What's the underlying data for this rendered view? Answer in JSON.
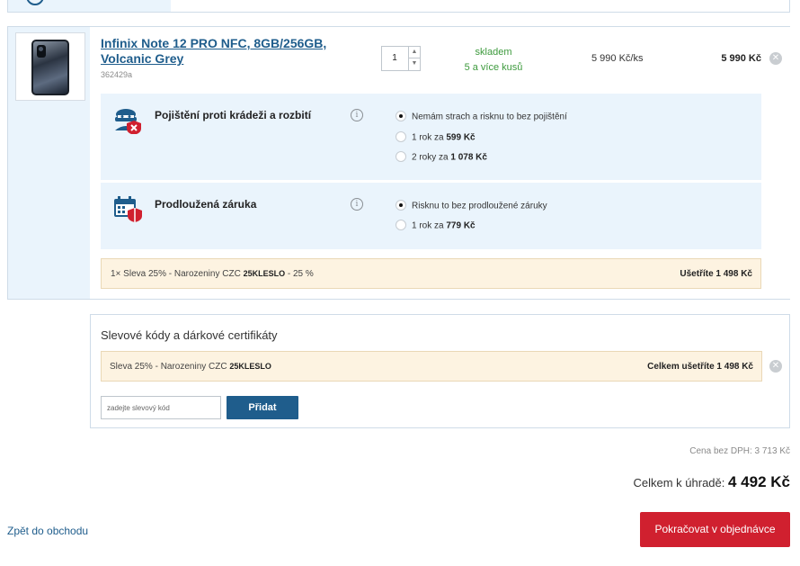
{
  "cart_item": {
    "product_name": "Infinix Note 12 PRO NFC, 8GB/256GB, Volcanic Grey",
    "product_code": "362429a",
    "quantity": "1",
    "stock_status": "skladem",
    "stock_detail": "5 a více kusů",
    "unit_price": "5 990 Kč/ks",
    "total_price": "5 990 Kč",
    "remove_icon": "close-icon"
  },
  "insurance": {
    "title": "Pojištění proti krádeži a rozbití",
    "icon": "thief-shield-icon",
    "options": [
      {
        "text": "Nemám strach a risknu to bez pojištění",
        "price": "",
        "selected": true
      },
      {
        "text": "1 rok za ",
        "price": "599 Kč",
        "selected": false
      },
      {
        "text": "2 roky za ",
        "price": "1 078 Kč",
        "selected": false
      }
    ]
  },
  "warranty": {
    "title": "Prodloužená záruka",
    "icon": "calendar-shield-icon",
    "options": [
      {
        "text": "Risknu to bez prodloužené záruky",
        "price": "",
        "selected": true
      },
      {
        "text": "1 rok za ",
        "price": "779 Kč",
        "selected": false
      }
    ]
  },
  "item_discount": {
    "prefix": "1× Sleva 25% - Narozeniny CZC ",
    "code": "25KLESLO",
    "suffix": " - 25 %",
    "saving": "Ušetříte 1 498 Kč"
  },
  "coupons": {
    "title": "Slevové kódy a dárkové certifikáty",
    "applied_prefix": "Sleva 25% - Narozeniny CZC ",
    "applied_code": "25KLESLO",
    "applied_saving": "Celkem ušetříte 1 498 Kč",
    "input_placeholder": "zadejte slevový kód",
    "add_label": "Přidat"
  },
  "summary": {
    "net_price": "Cena bez DPH: 3 713 Kč",
    "total_label": "Celkem k úhradě: ",
    "total_value": "4 492 Kč"
  },
  "footer": {
    "back_label": "Zpět do obchodu",
    "continue_label": "Pokračovat v objednávce"
  },
  "colors": {
    "link_blue": "#1f5d8c",
    "panel_blue": "#eaf4fc",
    "discount_bg": "#fdf3e1",
    "stock_green": "#3d9a3d",
    "cta_red": "#d0202f"
  }
}
